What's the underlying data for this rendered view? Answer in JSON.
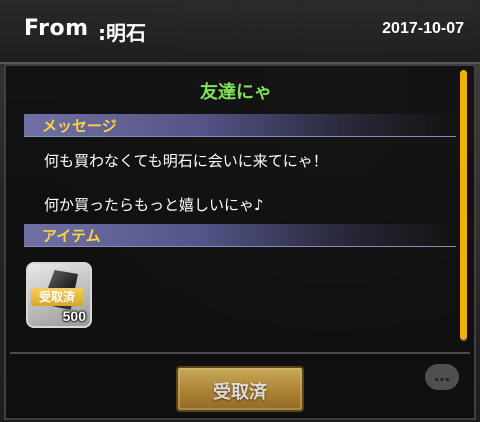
{
  "header": {
    "from_label": "From",
    "sender": ":明石",
    "date": "2017-10-07"
  },
  "mail": {
    "subject": "友達にゃ",
    "message_section_label": "メッセージ",
    "message_lines": [
      "何も買わなくても明石に会いに来てにゃ！",
      "何か買ったらもっと嬉しいにゃ♪"
    ],
    "item_section_label": "アイテム",
    "items": [
      {
        "icon": "gem-shard-icon",
        "tag": "受取済",
        "count": "500"
      }
    ]
  },
  "footer": {
    "claim_button_label": "受取済",
    "chat_icon": "chat-bubble-icon"
  },
  "colors": {
    "subject": "#7ee35a",
    "section_label": "#ffd23f",
    "scroll_thumb": "#f0b400",
    "button_gold": "#c9973a"
  }
}
